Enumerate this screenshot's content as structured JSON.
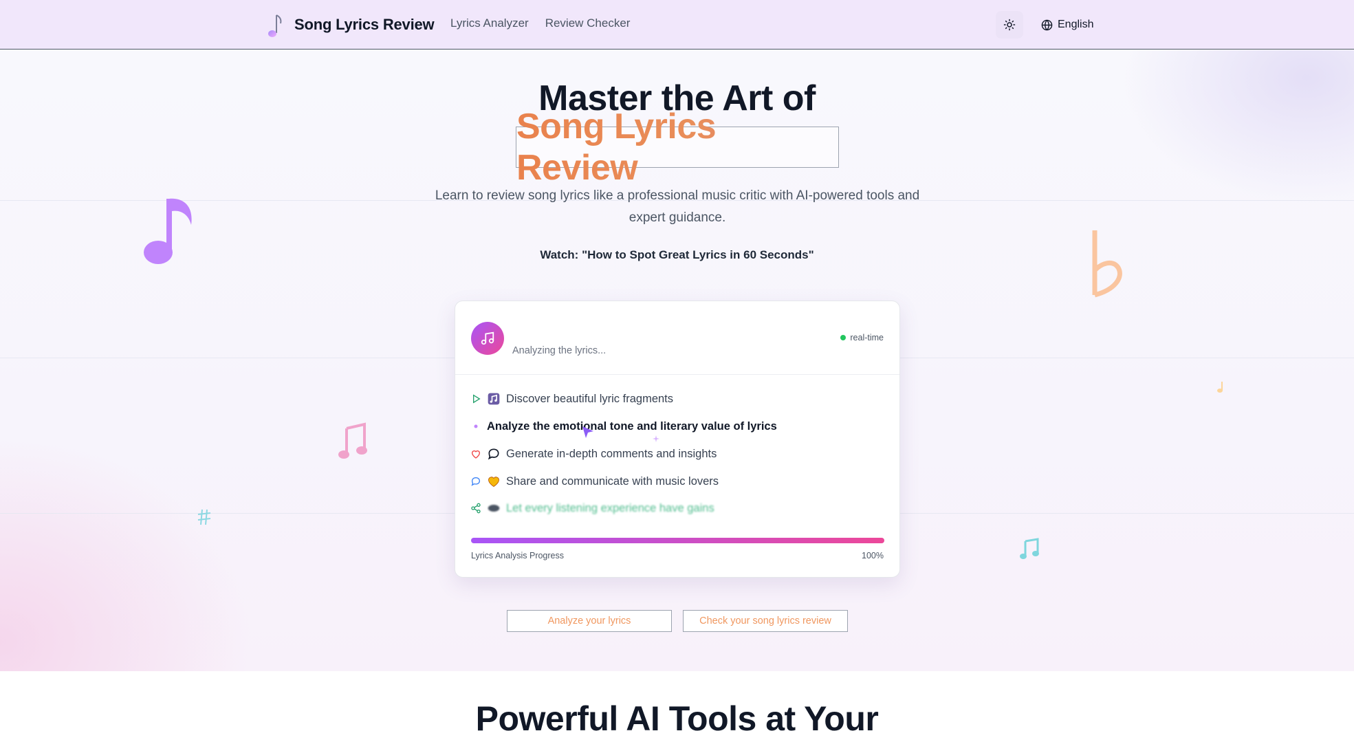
{
  "header": {
    "brand": "Song Lyrics Review",
    "nav": [
      "Lyrics Analyzer",
      "Review Checker"
    ],
    "language": "English",
    "theme_icon": "sun-icon",
    "language_icon": "globe-icon"
  },
  "hero": {
    "title_line1": "Master the Art of",
    "title_line2": "Song Lyrics Review",
    "subtitle": "Learn to review song lyrics like a professional music critic with AI-powered tools and expert guidance.",
    "watch": "Watch: \"How to Spot Great Lyrics in 60 Seconds\""
  },
  "card": {
    "status_text": "Analyzing the lyrics...",
    "badge": "real-time",
    "steps": [
      {
        "icon": "play-icon",
        "emoji": "musical-score-emoji",
        "text": "Discover beautiful lyric fragments"
      },
      {
        "icon": "bullet-dot",
        "emoji": "",
        "text": "Analyze the emotional tone and literary value of lyrics"
      },
      {
        "icon": "heart-icon",
        "emoji": "speech-balloon-emoji",
        "text": "Generate in-depth comments and insights"
      },
      {
        "icon": "chat-icon",
        "emoji": "yellow-heart-emoji",
        "text": "Share and communicate with music lovers"
      },
      {
        "icon": "share-icon",
        "emoji": "sunglasses-emoji",
        "text": "Let every listening experience have gains"
      }
    ],
    "progress_label": "Lyrics Analysis Progress",
    "progress_value": "100%",
    "progress_fraction": 1.0
  },
  "cta": {
    "analyze": "Analyze your lyrics",
    "check": "Check your song lyrics review"
  },
  "section2": {
    "title": "Powerful AI Tools at Your"
  },
  "colors": {
    "header_bg": "#f1e7fb",
    "accent_gradient_start": "#a855f7",
    "accent_gradient_end": "#ec4899",
    "title_orange": "#e9824d",
    "cta_text": "#f0975f",
    "status_green": "#22c55e"
  }
}
